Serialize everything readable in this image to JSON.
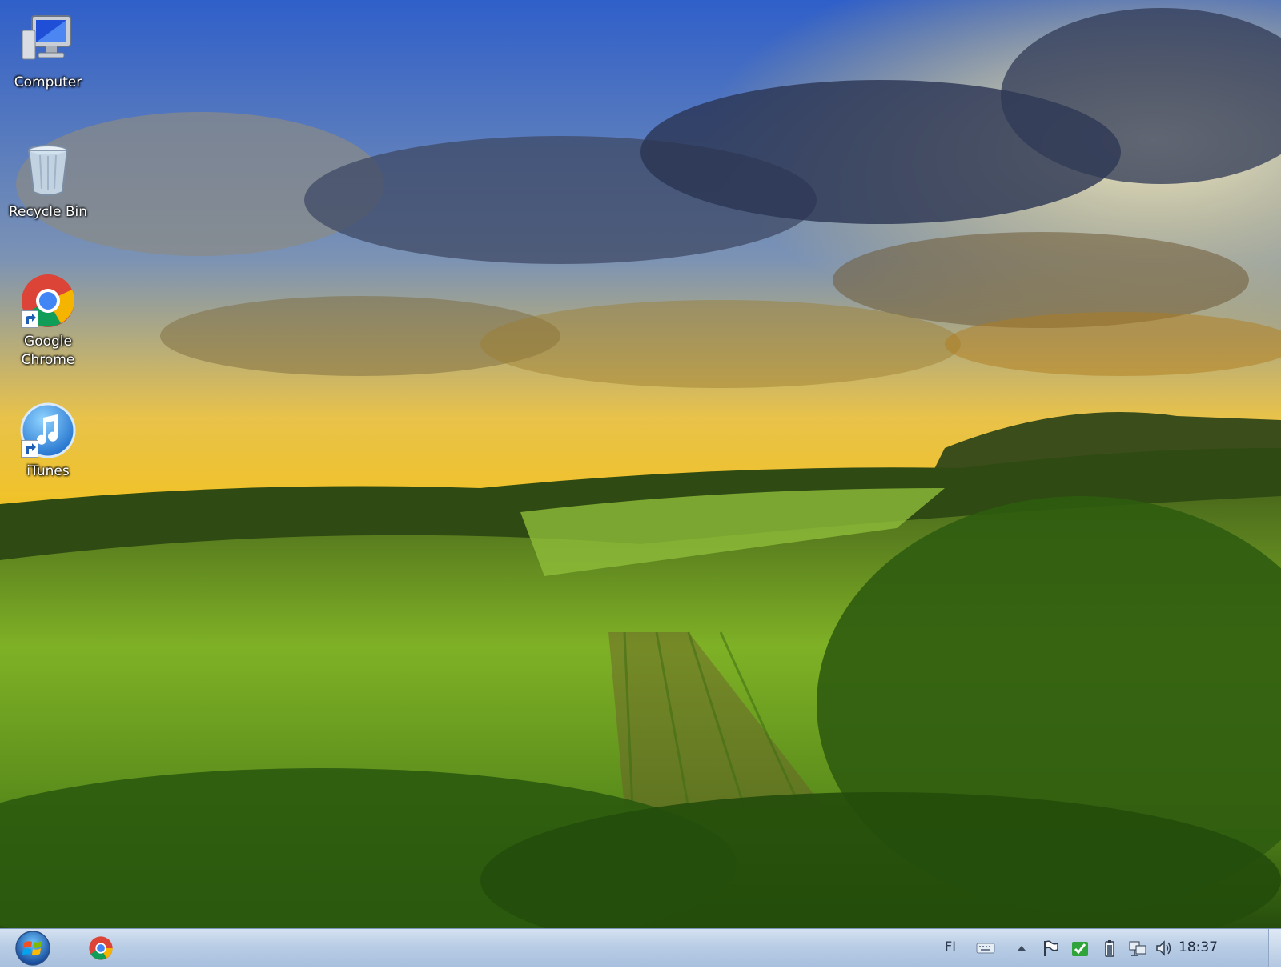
{
  "desktop": {
    "icons": [
      {
        "label": "Computer",
        "icon": "computer-icon"
      },
      {
        "label": "Recycle Bin",
        "icon": "recycle-bin-icon"
      },
      {
        "label": "Google\nChrome",
        "icon": "google-chrome-icon"
      },
      {
        "label": "iTunes",
        "icon": "itunes-icon"
      }
    ]
  },
  "taskbar": {
    "pinned": [
      {
        "icon": "google-chrome-icon"
      }
    ],
    "tray": {
      "language": "FI",
      "clock": "18:37"
    }
  },
  "colors": {
    "taskbar": "#b9cde5",
    "sky_blue": "#2c5bb8",
    "sunset": "#f2b516",
    "field_green": "#6fa31d"
  }
}
